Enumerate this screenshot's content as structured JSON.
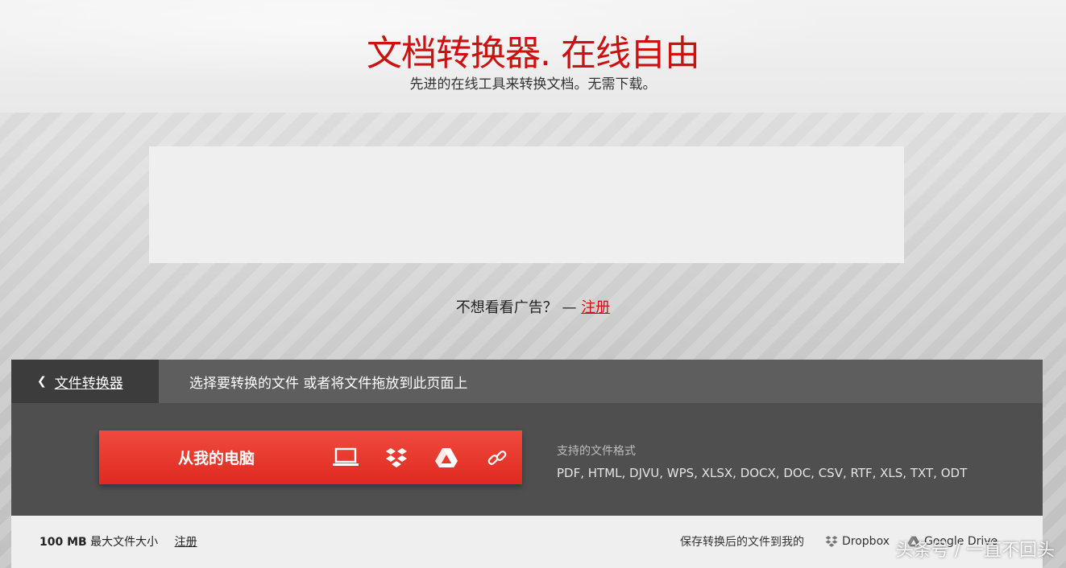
{
  "header": {
    "title": "文档转换器. 在线自由",
    "subtitle": "先进的在线工具来转换文档。无需下载。"
  },
  "ads": {
    "question": "不想看看广告？ —",
    "signup": "注册"
  },
  "converter": {
    "back_label": "文件转换器",
    "hint": "选择要转换的文件 或者将文件拖放到此页面上",
    "upload_label": "从我的电脑",
    "sources": [
      "laptop-icon",
      "dropbox-icon",
      "google-drive-icon",
      "link-icon"
    ],
    "formats_label": "支持的文件格式",
    "formats": "PDF, HTML, DJVU, WPS, XLSX, DOCX, DOC, CSV, RTF, XLS, TXT, ODT"
  },
  "footer": {
    "max_size_value": "100 MB",
    "max_size_text": "最大文件大小",
    "signup": "注册",
    "save_to_text": "保存转换后的文件到我的",
    "dropbox": "Dropbox",
    "gdrive": "Google Drive"
  },
  "watermark": "头条号 / 一直不回头",
  "colors": {
    "accent": "#cc1111",
    "button": "#e8352b",
    "panel": "#4f4f4f"
  }
}
